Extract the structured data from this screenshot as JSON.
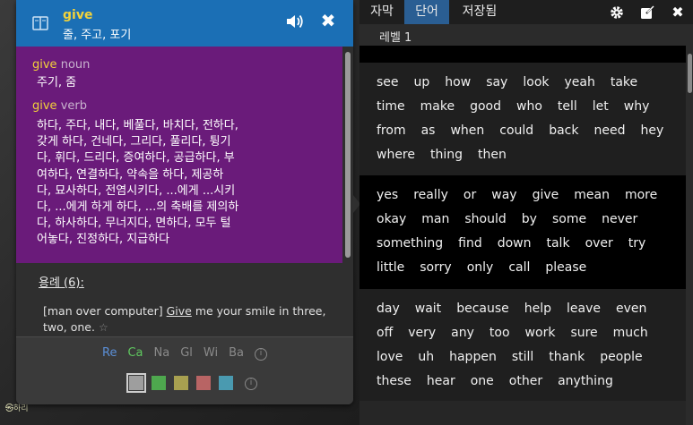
{
  "overlay": {
    "logo_text": "㉿하리"
  },
  "dictionary": {
    "word": "give",
    "summary": "줄, 주고, 포기",
    "entries": [
      {
        "word": "give",
        "pos": "noun",
        "definition": "주기, 줌"
      },
      {
        "word": "give",
        "pos": "verb",
        "definition_lines": [
          "하다, 주다, 내다, 베풀다, 바치다, 전하다,",
          "갖게 하다, 건네다, 그리다, 풀리다, 튕기",
          "다, 휘다, 드리다, 증여하다, 공급하다, 부",
          "여하다, 연결하다, 약속을 하다, 제공하",
          "다, 묘사하다, 전염시키다, ...에게 ...시키",
          "다, ...에게 하게 하다, ...의 축배를 제의하",
          "다, 하사하다, 무너지다, 면하다, 모두 털",
          "어놓다, 진정하다, 지급하다"
        ]
      }
    ],
    "examples_heading": "용례 (6):",
    "example": {
      "prefix": "[man over computer] ",
      "highlight": "Give",
      "rest": " me your smile in three, two, one. "
    },
    "sources": [
      {
        "label": "Re",
        "color": "#5b8fd6"
      },
      {
        "label": "Ca",
        "color": "#5fc85f"
      },
      {
        "label": "Na",
        "color": "#8a8a8a"
      },
      {
        "label": "Gl",
        "color": "#8a8a8a"
      },
      {
        "label": "Wi",
        "color": "#8a8a8a"
      },
      {
        "label": "Ba",
        "color": "#8a8a8a"
      }
    ],
    "info_icon": "i",
    "swatches": [
      "#9e9e9e",
      "#4ea84e",
      "#a8a050",
      "#b86464",
      "#4a9ab0"
    ],
    "colors": {
      "header": "#1b6fb5",
      "defs_bg": "#6a1b7a",
      "accent": "#f2d23a"
    }
  },
  "panel": {
    "tabs": [
      {
        "label": "자막",
        "active": false
      },
      {
        "label": "단어",
        "active": true
      },
      {
        "label": "저장됨",
        "active": false
      }
    ],
    "level_label": "레벨 1",
    "word_groups": [
      {
        "rows": [
          [
            "see",
            "up",
            "how",
            "say",
            "look",
            "yeah",
            "take"
          ],
          [
            "time",
            "make",
            "good",
            "who",
            "tell",
            "let",
            "why"
          ],
          [
            "from",
            "as",
            "when",
            "could",
            "back",
            "need",
            "hey"
          ],
          [
            "where",
            "thing",
            "then"
          ]
        ]
      },
      {
        "rows": [
          [
            "yes",
            "really",
            "or",
            "way",
            "give",
            "mean",
            "more"
          ],
          [
            "okay",
            "man",
            "should",
            "by",
            "some",
            "never"
          ],
          [
            "something",
            "find",
            "down",
            "talk",
            "over",
            "try"
          ],
          [
            "little",
            "sorry",
            "only",
            "call",
            "please"
          ]
        ]
      },
      {
        "rows": [
          [
            "day",
            "wait",
            "because",
            "help",
            "leave",
            "even"
          ],
          [
            "off",
            "very",
            "any",
            "too",
            "work",
            "sure",
            "much"
          ],
          [
            "love",
            "uh",
            "happen",
            "still",
            "thank",
            "people"
          ],
          [
            "these",
            "hear",
            "one",
            "other",
            "anything"
          ]
        ]
      }
    ]
  }
}
